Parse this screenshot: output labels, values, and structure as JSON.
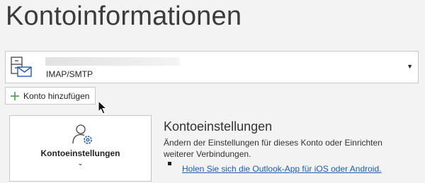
{
  "page": {
    "title": "Kontoinformationen"
  },
  "account": {
    "name": "",
    "type": "IMAP/SMTP",
    "icon": "mail-account-icon",
    "dropdown_icon": "▼"
  },
  "add_account": {
    "label": "Konto hinzufügen",
    "icon": "plus-icon"
  },
  "settings_tile": {
    "label": "Kontoeinstellungen",
    "icon": "user-settings-icon",
    "chevron": "⌄"
  },
  "settings_section": {
    "heading": "Kontoeinstellungen",
    "description": "Ändern der Einstellungen für dieses Konto oder Einrichten weiterer Verbindungen.",
    "link": "Holen Sie sich die Outlook-App für iOS oder Android."
  },
  "colors": {
    "background": "#f3f3f3",
    "accent": "#1d5bb8",
    "plus": "#2e8b3a"
  }
}
